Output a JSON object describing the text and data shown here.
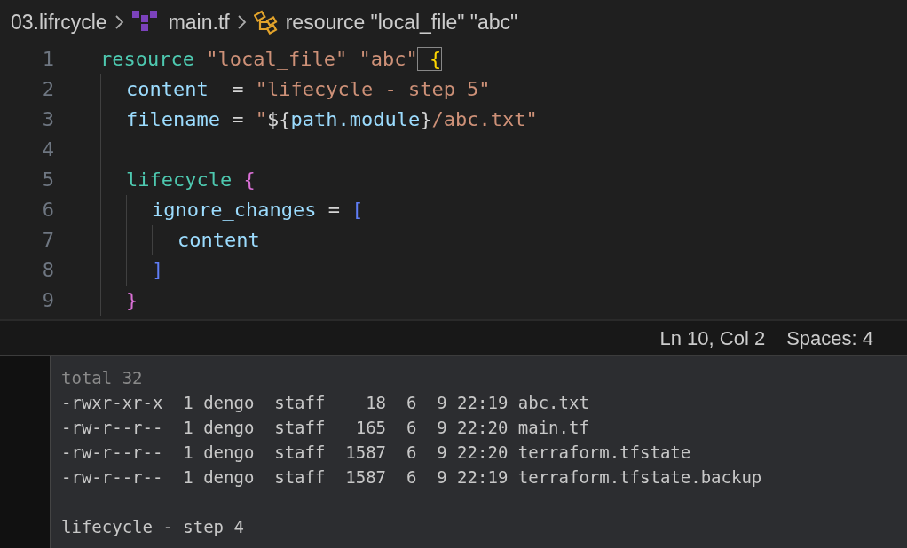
{
  "breadcrumb": [
    "03.lifrcycle",
    "main.tf",
    "resource \"local_file\" \"abc\""
  ],
  "code_lines": [
    {
      "number": "1",
      "tokens": [
        {
          "text": "resource",
          "kind": "keyword"
        },
        {
          "text": " \"local_file\"",
          "kind": "string"
        },
        {
          "text": " \"abc\"",
          "kind": "string"
        },
        {
          "text": " {",
          "kind": "brace-match"
        }
      ],
      "children": [
        {
          "number": "2",
          "tokens": [
            {
              "text": "content",
              "kind": "attr"
            },
            {
              "text": "  = ",
              "kind": "plain"
            },
            {
              "text": "\"lifecycle - step 5\"",
              "kind": "string"
            }
          ]
        },
        {
          "number": "3",
          "tokens": [
            {
              "text": "filename",
              "kind": "attr"
            },
            {
              "text": " = ",
              "kind": "plain"
            },
            {
              "text": "\"",
              "kind": "string"
            },
            {
              "text": "${",
              "kind": "plain"
            },
            {
              "text": "path.module",
              "kind": "attr"
            },
            {
              "text": "}",
              "kind": "plain"
            },
            {
              "text": "/abc.txt\"",
              "kind": "string"
            }
          ]
        },
        {
          "number": "4"
        },
        {
          "number": "5",
          "tokens": [
            {
              "text": "lifecycle",
              "kind": "keyword"
            },
            {
              "text": " {",
              "kind": "brace2"
            }
          ],
          "children": [
            {
              "number": "6",
              "tokens": [
                {
                  "text": "ignore_changes",
                  "kind": "attr"
                },
                {
                  "text": " = ",
                  "kind": "plain"
                },
                {
                  "text": "[",
                  "kind": "brace3"
                }
              ],
              "children": [
                {
                  "number": "7",
                  "tokens": [
                    {
                      "text": "content",
                      "kind": "attr"
                    }
                  ]
                }
              ]
            },
            {
              "number": "8",
              "tokens": [
                {
                  "text": "]",
                  "kind": "brace3"
                }
              ]
            }
          ]
        },
        {
          "number": "9",
          "tokens": [
            {
              "text": "}",
              "kind": "brace2"
            }
          ]
        }
      ]
    }
  ],
  "status_bar": [
    "Ln 10, Col 2",
    "Spaces: 4"
  ],
  "terminal": {
    "listing": [
      "total 32",
      "-rwxr-xr-x  1 dengo  staff    18  6  9 22:19 abc.txt",
      "-rw-r--r--  1 dengo  staff   165  6  9 22:20 main.tf",
      "-rw-r--r--  1 dengo  staff  1587  6  9 22:20 terraform.tfstate",
      "-rw-r--r--  1 dengo  staff  1587  6  9 22:19 terraform.tfstate.backup"
    ],
    "output": "lifecycle - step 4"
  }
}
